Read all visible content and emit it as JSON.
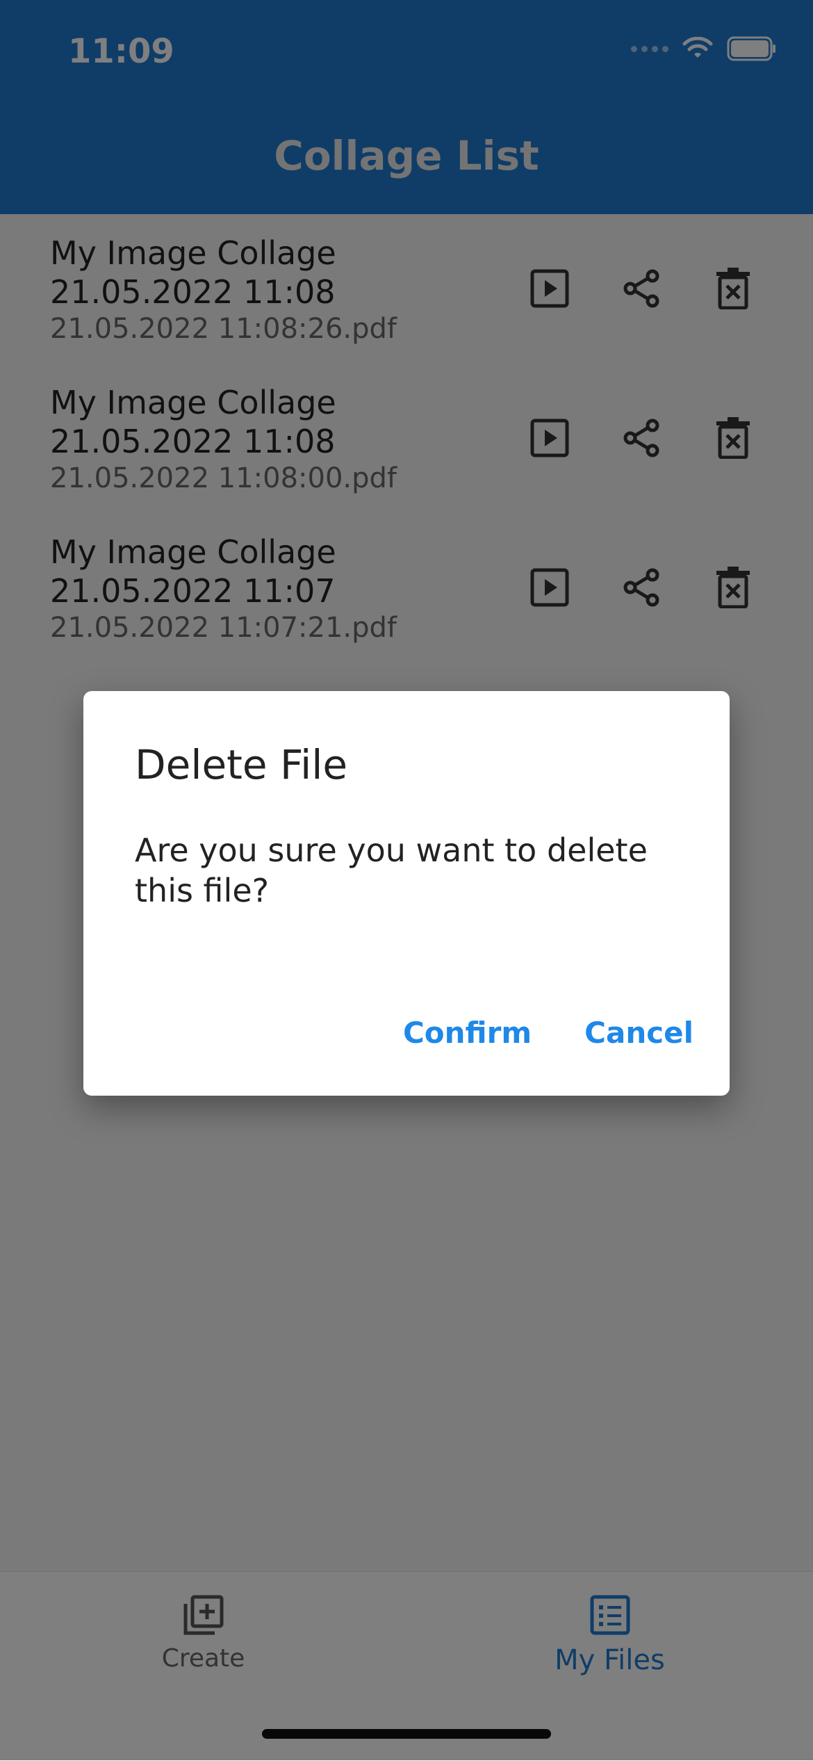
{
  "status_bar": {
    "time": "11:09"
  },
  "header": {
    "title": "Collage List"
  },
  "items": [
    {
      "title": "My Image Collage 21.05.2022 11:08",
      "file": "21.05.2022 11:08:26.pdf"
    },
    {
      "title": "My Image Collage 21.05.2022 11:08",
      "file": "21.05.2022 11:08:00.pdf"
    },
    {
      "title": "My Image Collage 21.05.2022 11:07",
      "file": "21.05.2022 11:07:21.pdf"
    }
  ],
  "icons": {
    "play": "play-icon",
    "share": "share-icon",
    "delete": "trash-icon"
  },
  "bottom_nav": {
    "create_label": "Create",
    "files_label": "My Files",
    "active": "My Files"
  },
  "dialog": {
    "title": "Delete File",
    "message": "Are you sure you want to delete this file?",
    "confirm_label": "Confirm",
    "cancel_label": "Cancel"
  },
  "colors": {
    "primary": "#1f7ad1",
    "dialog_action": "#1f88e8",
    "scrim": "rgba(0,0,0,0.5)"
  }
}
